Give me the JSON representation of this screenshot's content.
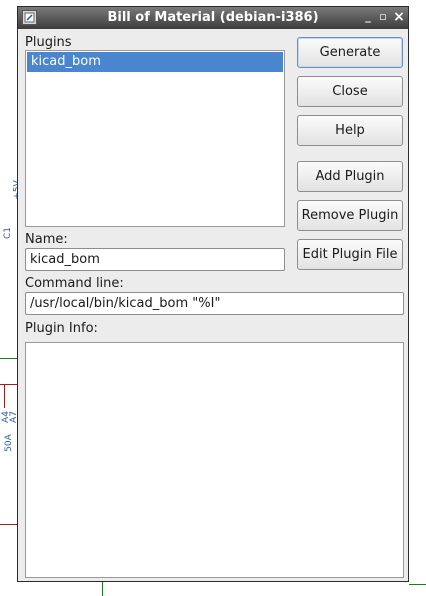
{
  "window": {
    "title": "Bill of Material (debian-i386)",
    "controls": {
      "minimize": "_",
      "maximize": "▫",
      "close": "×"
    }
  },
  "plugins": {
    "label": "Plugins",
    "items": [
      "kicad_bom"
    ],
    "selected_index": 0
  },
  "buttons": {
    "generate": "Generate",
    "close": "Close",
    "help": "Help",
    "add_plugin": "Add Plugin",
    "remove_plugin": "Remove Plugin",
    "edit_plugin_file": "Edit Plugin File"
  },
  "name": {
    "label": "Name:",
    "value": "kicad_bom"
  },
  "command_line": {
    "label": "Command line:",
    "value": "/usr/local/bin/kicad_bom \"%I\""
  },
  "plugin_info": {
    "label": "Plugin Info:",
    "value": ""
  },
  "background": {
    "labels": [
      "+5V",
      "C1",
      "A4",
      "A7",
      "50A"
    ]
  },
  "colors": {
    "selection": "#4a86cf",
    "titlebar": "#3c3c3c",
    "dialog_bg": "#ececec"
  }
}
